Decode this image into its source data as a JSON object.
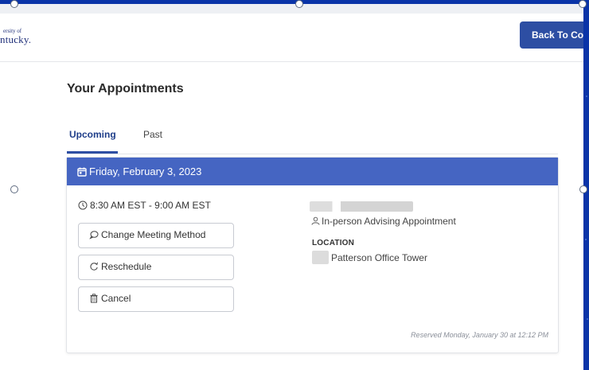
{
  "header": {
    "logo_small": "ersity of",
    "logo_big": "ntucky.",
    "back_button": "Back To Cou"
  },
  "page": {
    "title": "Your Appointments",
    "tabs": [
      {
        "label": "Upcoming",
        "active": true
      },
      {
        "label": "Past",
        "active": false
      }
    ]
  },
  "appointment": {
    "date": "Friday, February 3, 2023",
    "time": "8:30 AM EST - 9:00 AM EST",
    "actions": {
      "change_method": "Change Meeting Method",
      "reschedule": "Reschedule",
      "cancel": "Cancel"
    },
    "type": "In-person Advising Appointment",
    "location_label": "LOCATION",
    "location": "Patterson Office Tower",
    "reserved": "Reserved Monday, January 30 at 12:12 PM"
  },
  "colors": {
    "accent": "#2d4ea3",
    "card_header": "#4565c2",
    "desktop_bg": "#0a34a8"
  }
}
